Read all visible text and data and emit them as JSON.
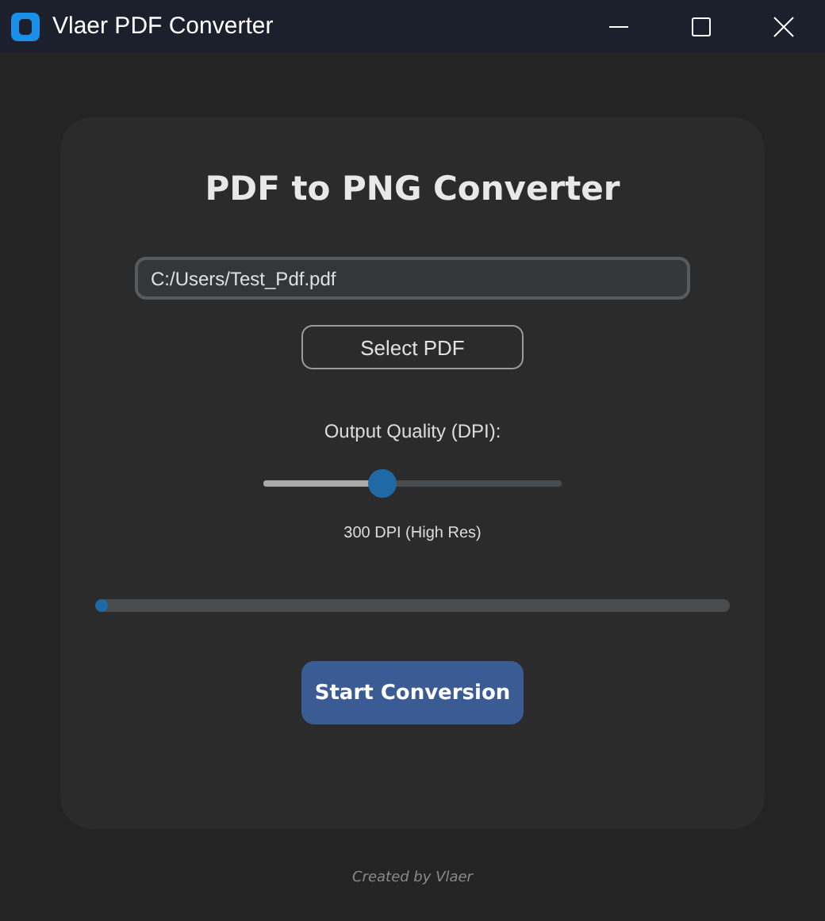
{
  "window": {
    "title": "Vlaer PDF Converter"
  },
  "heading": "PDF to PNG Converter",
  "file_field": {
    "value": "C:/Users/Test_Pdf.pdf"
  },
  "select_button": "Select PDF",
  "quality": {
    "label": "Output Quality (DPI):",
    "level": 0.4,
    "reading": "300 DPI (High Res)"
  },
  "progress": {
    "level": 0.02
  },
  "start_button": "Start Conversion",
  "footer": "Created by Vlaer"
}
